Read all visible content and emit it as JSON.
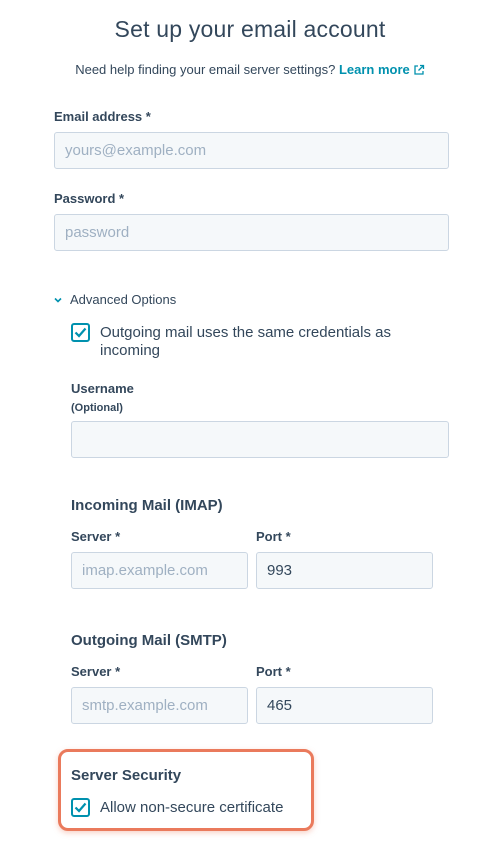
{
  "header": {
    "title": "Set up your email account",
    "help_text": "Need help finding your email server settings?",
    "learn_more": "Learn more"
  },
  "email": {
    "label": "Email address *",
    "placeholder": "yours@example.com",
    "value": ""
  },
  "password": {
    "label": "Password *",
    "placeholder": "password",
    "value": ""
  },
  "advanced": {
    "toggle_label": "Advanced Options",
    "same_credentials": {
      "label_line1": "Outgoing mail uses the same credentials as",
      "label_line2": "incoming",
      "checked": true
    },
    "username": {
      "label": "Username",
      "hint": "(Optional)",
      "value": ""
    }
  },
  "imap": {
    "title": "Incoming Mail (IMAP)",
    "server_label": "Server *",
    "server_placeholder": "imap.example.com",
    "port_label": "Port *",
    "port_value": "993"
  },
  "smtp": {
    "title": "Outgoing Mail (SMTP)",
    "server_label": "Server *",
    "server_placeholder": "smtp.example.com",
    "port_label": "Port *",
    "port_value": "465"
  },
  "security": {
    "title": "Server Security",
    "allow_nonsecure": {
      "label": "Allow non-secure certificate",
      "checked": true
    }
  },
  "colors": {
    "accent": "#0091ae",
    "text": "#33475b",
    "highlight": "#ea7a5c",
    "input_bg": "#f5f8fa",
    "input_border": "#cbd6e2"
  }
}
